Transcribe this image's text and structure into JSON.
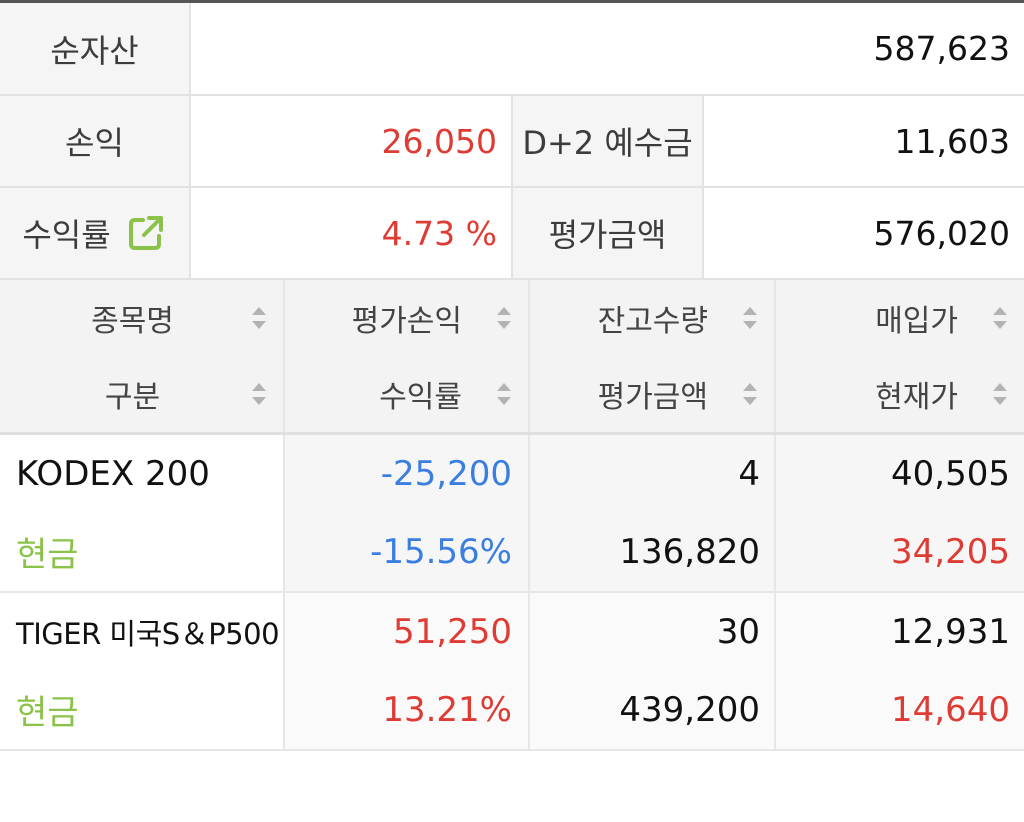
{
  "summary": {
    "net_assets_label": "순자산",
    "net_assets_value": "587,623",
    "pnl_label": "손익",
    "pnl_value": "26,050",
    "deposit_label": "D+2 예수금",
    "deposit_value": "11,603",
    "return_label": "수익률",
    "return_value": "4.73 %",
    "eval_label": "평가금액",
    "eval_value": "576,020"
  },
  "grid": {
    "headers_top": [
      "종목명",
      "평가손익",
      "잔고수량",
      "매입가"
    ],
    "headers_bottom": [
      "구분",
      "수익률",
      "평가금액",
      "현재가"
    ],
    "rows": [
      {
        "name": "KODEX 200",
        "type": "현금",
        "pnl": "-25,200",
        "return": "-15.56%",
        "quantity": "4",
        "eval_amount": "136,820",
        "buy_price": "40,505",
        "current_price": "34,205"
      },
      {
        "name": "TIGER 미국S＆P500",
        "type": "현금",
        "pnl": "51,250",
        "return": "13.21%",
        "quantity": "30",
        "eval_amount": "439,200",
        "buy_price": "12,931",
        "current_price": "14,640"
      }
    ]
  },
  "colors": {
    "positive": "#dd3b33",
    "negative": "#3a7ee0",
    "type_label": "#8bc34a",
    "icon": "#8bc34a"
  },
  "icons": {
    "share": "share-external-icon",
    "sort": "sort-updown-icon"
  }
}
